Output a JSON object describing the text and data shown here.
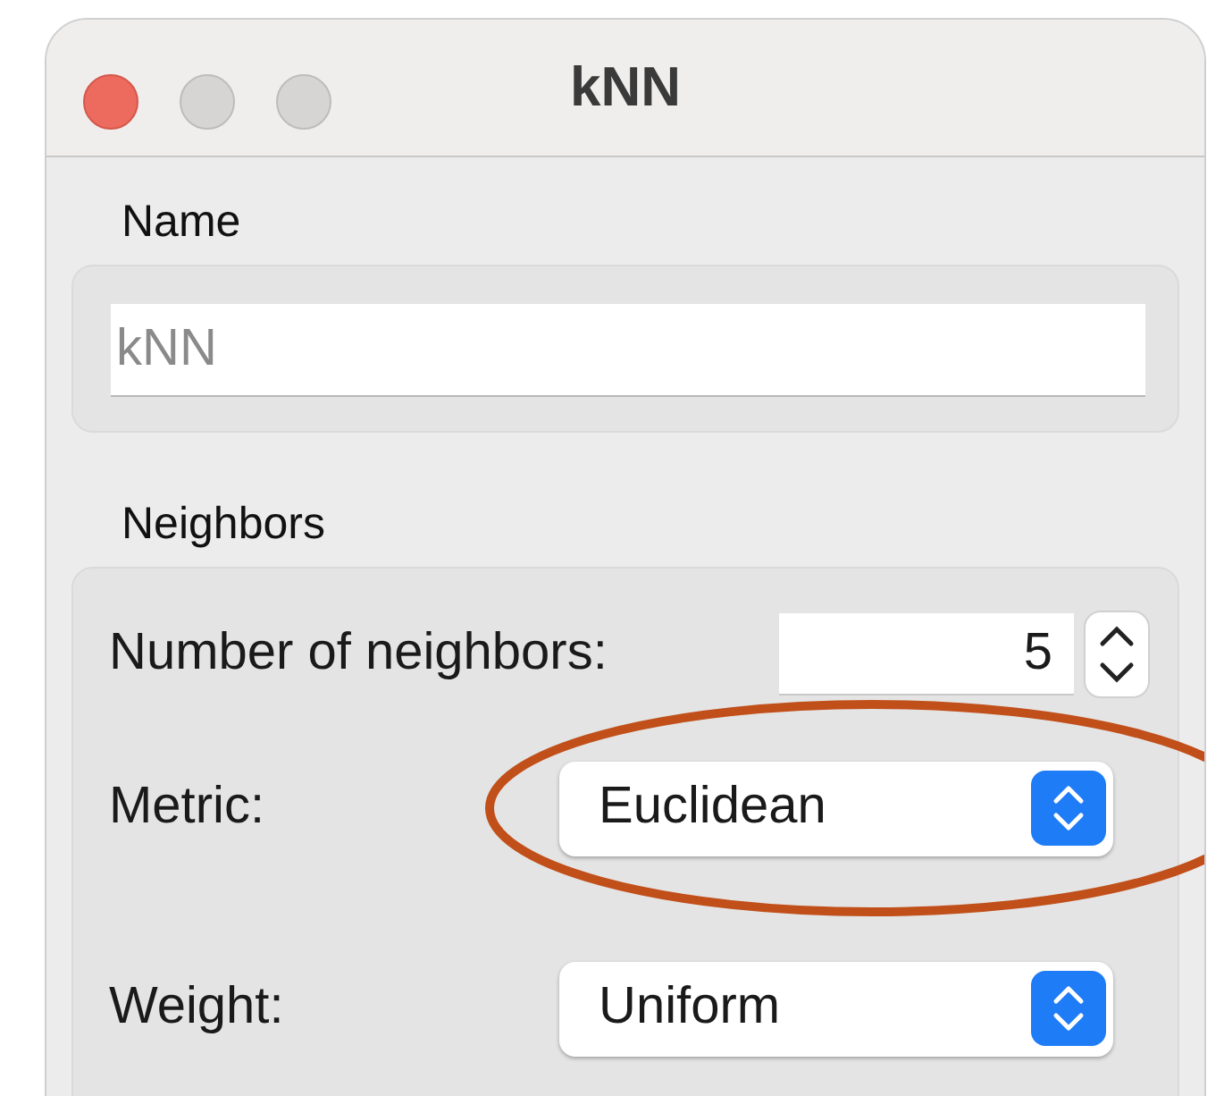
{
  "window": {
    "title": "kNN"
  },
  "name_section": {
    "label": "Name",
    "field": {
      "placeholder": "kNN"
    }
  },
  "neighbors_section": {
    "label": "Neighbors",
    "rows": [
      {
        "kind": "spin",
        "label": "Number of neighbors:",
        "value": "5"
      },
      {
        "kind": "popup",
        "label": "Metric:",
        "value": "Euclidean",
        "highlighted": true
      },
      {
        "kind": "popup",
        "label": "Weight:",
        "value": "Uniform",
        "highlighted": false
      }
    ]
  }
}
